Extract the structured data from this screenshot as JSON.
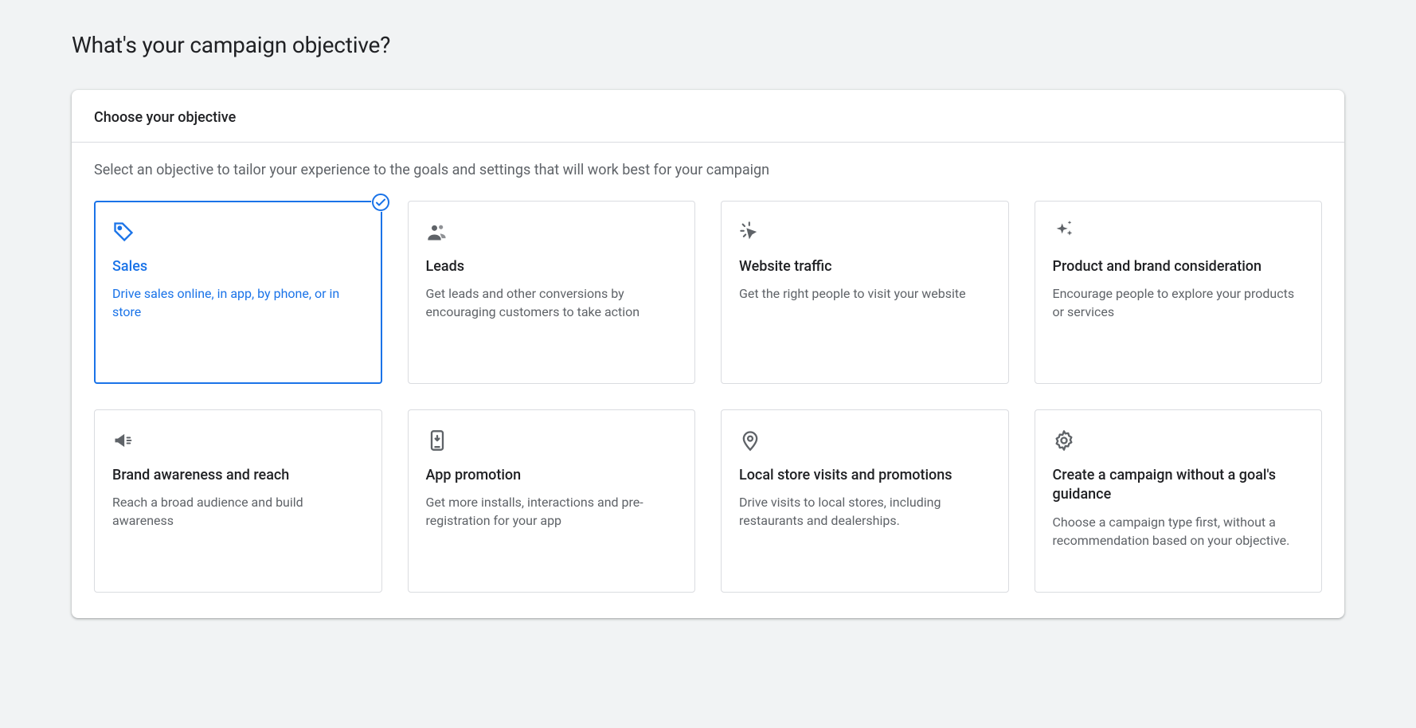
{
  "page_title": "What's your campaign objective?",
  "panel_header": "Choose your objective",
  "instructions": "Select an objective to tailor your experience to the goals and settings that will work best for your campaign",
  "objectives": [
    {
      "title": "Sales",
      "description": "Drive sales online, in app, by phone, or in store",
      "icon": "tag-icon",
      "selected": true
    },
    {
      "title": "Leads",
      "description": "Get leads and other conversions by encouraging customers to take action",
      "icon": "people-icon",
      "selected": false
    },
    {
      "title": "Website traffic",
      "description": "Get the right people to visit your website",
      "icon": "cursor-click-icon",
      "selected": false
    },
    {
      "title": "Product and brand consideration",
      "description": "Encourage people to explore your products or services",
      "icon": "sparkle-icon",
      "selected": false
    },
    {
      "title": "Brand awareness and reach",
      "description": "Reach a broad audience and build awareness",
      "icon": "megaphone-icon",
      "selected": false
    },
    {
      "title": "App promotion",
      "description": "Get more installs, interactions and pre-registration for your app",
      "icon": "app-download-icon",
      "selected": false
    },
    {
      "title": "Local store visits and promotions",
      "description": "Drive visits to local stores, including restaurants and dealerships.",
      "icon": "location-pin-icon",
      "selected": false
    },
    {
      "title": "Create a campaign without a goal's guidance",
      "description": "Choose a campaign type first, without a recommendation based on your objective.",
      "icon": "gear-icon",
      "selected": false
    }
  ]
}
